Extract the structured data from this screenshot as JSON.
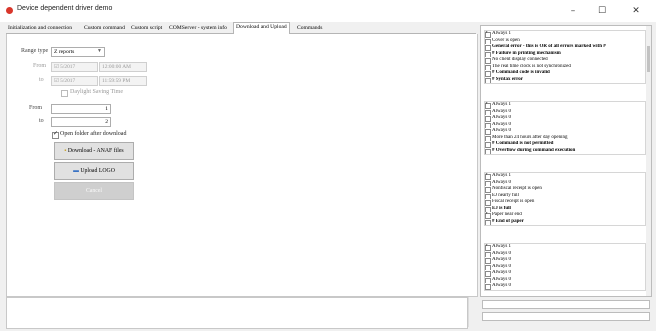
{
  "window": {
    "title": "Device dependent driver demo",
    "min": "–",
    "max": "☐",
    "close": "✕"
  },
  "tabs": [
    {
      "label": "Initialization and connection"
    },
    {
      "label": "Custom command"
    },
    {
      "label": "Custom script"
    },
    {
      "label": "COMServer - system info"
    },
    {
      "label": "Download and Upload",
      "selected": true
    },
    {
      "label": "Commands"
    }
  ],
  "form": {
    "range_type_label": "Range type",
    "range_type_value": "Z reports",
    "from_label": "From",
    "from_date": "☑  5/2017",
    "from_time": "12:00:00 AM",
    "to_label": "to",
    "to_date": "☑  5/2017",
    "to_time": "11:59:59 PM",
    "dst_label": "Daylight Saving Time",
    "from2_label": "From",
    "from2_value": "1",
    "to2_label": "to",
    "to2_value": "2",
    "open_folder_label": "Open folder after download",
    "download_btn": "Download - ANAF files",
    "upload_btn": "Upload LOGO",
    "cancel_btn": "Cancel"
  },
  "status_groups": [
    {
      "items": [
        {
          "t": "Always 1",
          "c": true
        },
        {
          "t": "Cover is open",
          "c": false
        },
        {
          "t": "General error - this is OR of all errors marked with #",
          "c": false,
          "b": true
        },
        {
          "t": "# Failure in printing mechanism",
          "c": false,
          "b": true
        },
        {
          "t": "No client display connected",
          "c": false
        },
        {
          "t": "The real time clock is not synchronized",
          "c": false
        },
        {
          "t": "# Command code is invalid",
          "c": false,
          "b": true
        },
        {
          "t": "# Syntax error",
          "c": false,
          "b": true
        }
      ]
    },
    {
      "items": [
        {
          "t": "Always 1",
          "c": true
        },
        {
          "t": "Always 0",
          "c": false
        },
        {
          "t": "Always 0",
          "c": false
        },
        {
          "t": "Always 0",
          "c": false
        },
        {
          "t": "Always 0",
          "c": false
        },
        {
          "t": "More than 24 hours after day opening",
          "c": false
        },
        {
          "t": "# Command is not permitted",
          "c": false,
          "b": true
        },
        {
          "t": "# Overflow during command execution",
          "c": false,
          "b": true
        }
      ]
    },
    {
      "items": [
        {
          "t": "Always 1",
          "c": true
        },
        {
          "t": "Always 0",
          "c": false
        },
        {
          "t": "Nonfiscal receipt is open",
          "c": false
        },
        {
          "t": "EJ nearly full",
          "c": false
        },
        {
          "t": "Fiscal receipt is open",
          "c": false
        },
        {
          "t": "EJ is full",
          "c": false,
          "b": true
        },
        {
          "t": "Paper near end",
          "c": true
        },
        {
          "t": "# End of paper",
          "c": false,
          "b": true
        }
      ]
    },
    {
      "items": [
        {
          "t": "Always 1",
          "c": true
        },
        {
          "t": "Always 0",
          "c": false
        },
        {
          "t": "Always 0",
          "c": false
        },
        {
          "t": "Always 0",
          "c": false
        },
        {
          "t": "Always 0",
          "c": false
        },
        {
          "t": "Always 0",
          "c": false
        },
        {
          "t": "Always 0",
          "c": false
        }
      ]
    }
  ]
}
